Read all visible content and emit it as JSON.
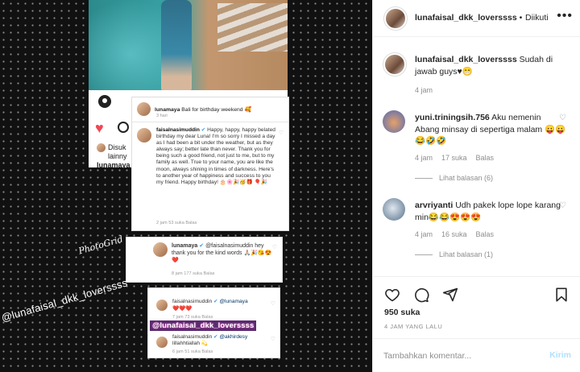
{
  "post_image": {
    "screenshot_1": {
      "disukai_text": "Disuk",
      "line2": "lainny",
      "line3": "lunamaya"
    },
    "comment_card_1": {
      "caption_user": "lunamaya",
      "caption_text": "Bali for birthday weekend 🥰",
      "caption_time": "3 hari",
      "reply_user": "faisalnasimuddin",
      "reply_text": "Happy, happy, happy belated birthday my dear Luna! I'm so sorry I missed a day as I had been a bit under the weather, but as they always say; better late than never. Thank you for being such a good friend, not just to me, but to my family as well. True to your name, you are like the moon, always shining in times of darkness. Here's to another year of happiness and success to you my friend. Happy birthday! 🎂🌸🎉🥳🎁 🎈🎉",
      "reply_meta": "2 jam    53 suka    Balas"
    },
    "comment_card_2": {
      "user": "lunamaya",
      "text": "@faisalnasimuddin hey thank you for the kind words 🙏🏼🎉😘😍❤️",
      "meta": "8 jam    177 suka    Balas"
    },
    "comment_card_3": {
      "line1_user": "faisalnasimuddin",
      "line1_text": "@lunamaya",
      "line1_emoji": "❤️❤️❤️",
      "line1_meta": "7 jam    73 suka    Balas",
      "stamp": "@lunafaisal_dkk_loverssss",
      "line2_user": "faisalnasimuddin",
      "line2_text": "@akhirdesy",
      "line2_sub": "lillahhtiallah 💫",
      "line2_meta": "6 jam    51 suka    Balas"
    },
    "watermark": "@lunafaisal_dkk_loverssss",
    "watermark_credit": "PhotoGrid"
  },
  "header": {
    "username": "lunafaisal_dkk_loverssss",
    "separator": "•",
    "follow_label": "Diikuti",
    "more_icon": "more-horizontal-icon"
  },
  "comments": [
    {
      "user": "lunafaisal_dkk_loverssss",
      "text": "Sudah di jawab guys♥😁",
      "time": "4 jam"
    },
    {
      "user": "yuni.triningsih.756",
      "text": "Aku nemenin Abang minsay di sepertiga malam 😛😛😂🤣🤣",
      "time": "4 jam",
      "likes": "17 suka",
      "reply": "Balas",
      "view_replies": "Lihat balasan (6)"
    },
    {
      "user": "arvriyanti",
      "text": "Udh pakek lope lope karang min😂😂😍😍😍",
      "time": "4 jam",
      "likes": "16 suka",
      "reply": "Balas",
      "view_replies": "Lihat balasan (1)"
    }
  ],
  "actions": {
    "likes": "950 suka",
    "timestamp": "4 JAM YANG LALU",
    "comment_placeholder": "Tambahkan komentar...",
    "send_label": "Kirim"
  },
  "colors": {
    "like_red": "#ed4956",
    "send_disabled": "#b2dffc",
    "meta_gray": "#8e8e8e"
  }
}
